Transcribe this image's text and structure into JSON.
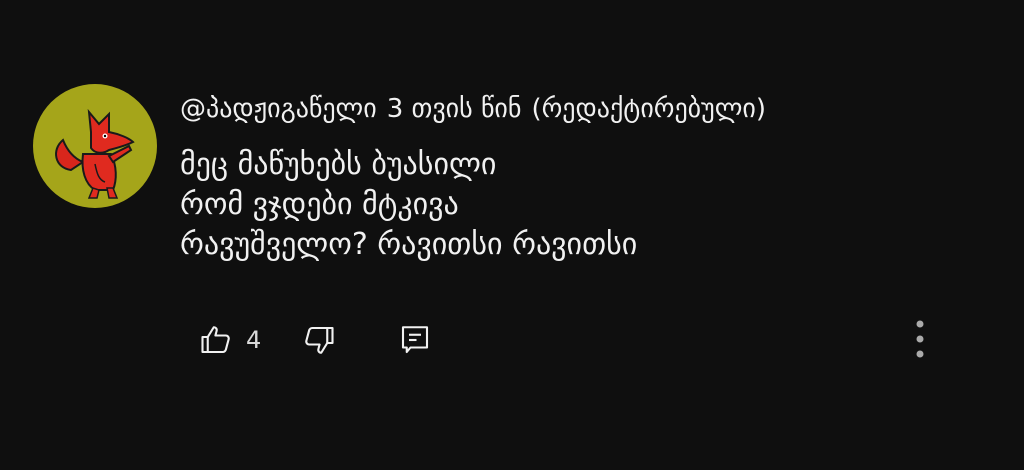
{
  "comment": {
    "author": "@პადჟიგაწელი",
    "timestamp": "3 თვის წინ",
    "edited_label": "(რედაქტირებული)",
    "lines": [
      "მეც მაწუხებს ბუასილი",
      "რომ ვჯდები მტკივა",
      "რავუშველო? რავითსი რავითსი"
    ],
    "like_count": "4"
  },
  "icons": {
    "avatar": "red-fox-cartoon-avatar",
    "like": "thumbs-up-icon",
    "dislike": "thumbs-down-icon",
    "reply": "reply-comment-icon",
    "more": "more-vertical-icon"
  },
  "colors": {
    "background": "#0f0f0f",
    "avatar_bg": "#a5a51a",
    "text": "#f1f1f1"
  }
}
